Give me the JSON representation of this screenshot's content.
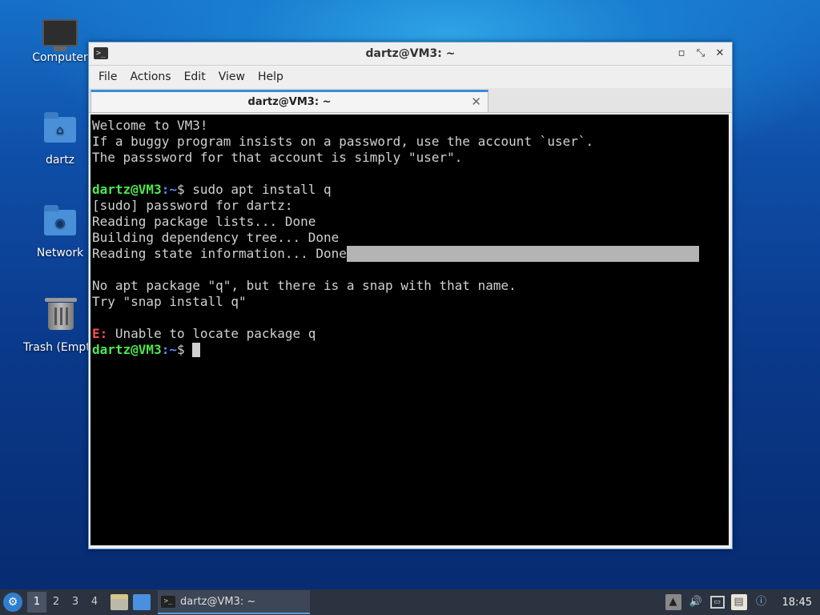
{
  "desktop": {
    "icons": [
      {
        "label": "Computer"
      },
      {
        "label": "dartz"
      },
      {
        "label": "Network"
      },
      {
        "label": "Trash (Empty)"
      }
    ]
  },
  "window": {
    "title": "dartz@VM3: ~",
    "controls": {
      "minimize": "▫",
      "maximize": "⤡",
      "close": "✕"
    },
    "menu": [
      "File",
      "Actions",
      "Edit",
      "View",
      "Help"
    ],
    "tab": {
      "label": "dartz@VM3: ~",
      "close": "✕"
    }
  },
  "terminal": {
    "welcome": [
      "Welcome to VM3!",
      "If a buggy program insists on a password, use the account `user`.",
      "The passsword for that account is simply \"user\"."
    ],
    "prompt_user": "dartz@VM3",
    "prompt_path": ":~",
    "prompt_sign": "$",
    "command": " sudo apt install q",
    "output": [
      "[sudo] password for dartz:",
      "Reading package lists... Done",
      "Building dependency tree... Done",
      "Reading state information... Done"
    ],
    "snap_msg": [
      "No apt package \"q\", but there is a snap with that name.",
      "Try \"snap install q\""
    ],
    "error_prefix": "E:",
    "error_msg": " Unable to locate package q"
  },
  "taskbar": {
    "start": "⚙",
    "workspaces": [
      "1",
      "2",
      "3",
      "4"
    ],
    "active_workspace": "1",
    "task_label": "dartz@VM3: ~",
    "clock": "18:45"
  }
}
